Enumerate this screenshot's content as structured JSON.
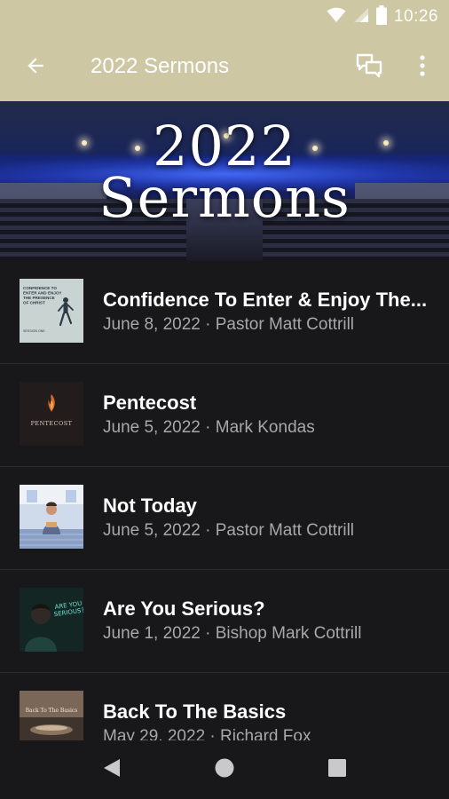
{
  "status_bar": {
    "time": "10:26",
    "icons": [
      "wifi-icon",
      "signal-icon",
      "battery-icon"
    ]
  },
  "app_bar": {
    "title": "2022 Sermons",
    "back_icon": "arrow-back-icon",
    "chat_icon": "chat-icon",
    "more_icon": "more-vert-icon"
  },
  "hero": {
    "line1": "2022",
    "line2": "Sermons"
  },
  "sermons": [
    {
      "title": "Confidence To Enter & Enjoy The...",
      "meta": "June 8, 2022 · Pastor Matt Cottrill",
      "thumb_text": "CONFIDENCE TO ENTER AND ENJOY THE PRESENCE OF CHRIST",
      "thumb_tag": "SESSION ONE"
    },
    {
      "title": "Pentecost",
      "meta": "June 5, 2022 · Mark Kondas",
      "thumb_text": "PENTECOST"
    },
    {
      "title": "Not Today",
      "meta": "June 5, 2022 · Pastor Matt Cottrill"
    },
    {
      "title": "Are You Serious?",
      "meta": "June 1, 2022 · Bishop Mark Cottrill",
      "thumb_text": "ARE YOU SERIOUS?"
    },
    {
      "title": "Back To The Basics",
      "meta": "May 29, 2022 · Richard Fox",
      "thumb_text": "Back To The Basics"
    }
  ],
  "nav_bar": {
    "icons": [
      "back-triangle-icon",
      "home-circle-icon",
      "recents-square-icon"
    ]
  },
  "colors": {
    "app_bar": "#cdc7a4",
    "background": "#18181a",
    "title_text": "#ffffff",
    "meta_text": "#a8a8a8"
  }
}
